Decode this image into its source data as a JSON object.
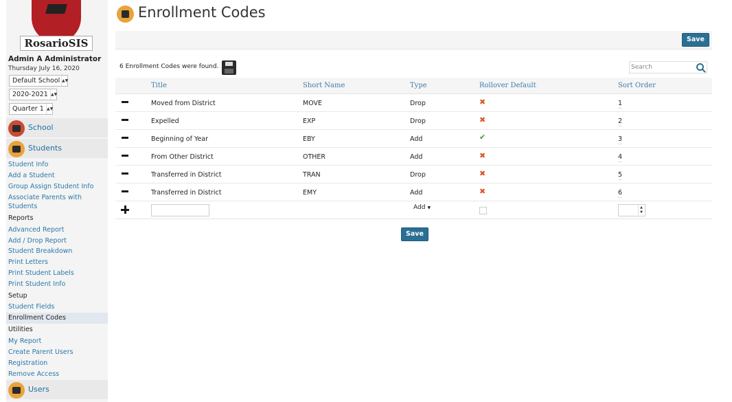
{
  "app": {
    "logo_text": "RosarioSIS",
    "user_name": "Admin A Administrator",
    "date": "Thursday July 16, 2020",
    "school_select": "Default School",
    "year_select": "2020-2021",
    "quarter_select": "Quarter 1"
  },
  "sidebar": {
    "school_label": "School",
    "students_label": "Students",
    "users_label": "Users",
    "items": [
      "Student Info",
      "Add a Student",
      "Group Assign Student Info",
      "Associate Parents with",
      "Students",
      "Reports",
      "Advanced Report",
      "Add / Drop Report",
      "Student Breakdown",
      "Print Letters",
      "Print Student Labels",
      "Print Student Info",
      "Setup",
      "Student Fields",
      "Enrollment Codes",
      "Utilities",
      "My Report",
      "Create Parent Users",
      "Registration",
      "Remove Access"
    ]
  },
  "page": {
    "title": "Enrollment Codes",
    "save_label": "Save",
    "found_text": "6 Enrollment Codes were found.",
    "search_placeholder": "Search"
  },
  "table": {
    "headers": {
      "title": "Title",
      "short_name": "Short Name",
      "type": "Type",
      "rollover": "Rollover Default",
      "sort_order": "Sort Order"
    },
    "rows": [
      {
        "title": "Moved from District",
        "short_name": "MOVE",
        "type": "Drop",
        "rollover": false,
        "sort_order": "1"
      },
      {
        "title": "Expelled",
        "short_name": "EXP",
        "type": "Drop",
        "rollover": false,
        "sort_order": "2"
      },
      {
        "title": "Beginning of Year",
        "short_name": "EBY",
        "type": "Add",
        "rollover": true,
        "sort_order": "3"
      },
      {
        "title": "From Other District",
        "short_name": "OTHER",
        "type": "Add",
        "rollover": false,
        "sort_order": "4"
      },
      {
        "title": "Transferred in District",
        "short_name": "TRAN",
        "type": "Drop",
        "rollover": false,
        "sort_order": "5"
      },
      {
        "title": "Transferred in District",
        "short_name": "EMY",
        "type": "Add",
        "rollover": false,
        "sort_order": "6"
      }
    ],
    "new_row_type": "Add"
  },
  "colors": {
    "accent": "#2b6f94",
    "link": "#2b78a8",
    "header": "#3b7cac",
    "brand": "#b21f24"
  }
}
